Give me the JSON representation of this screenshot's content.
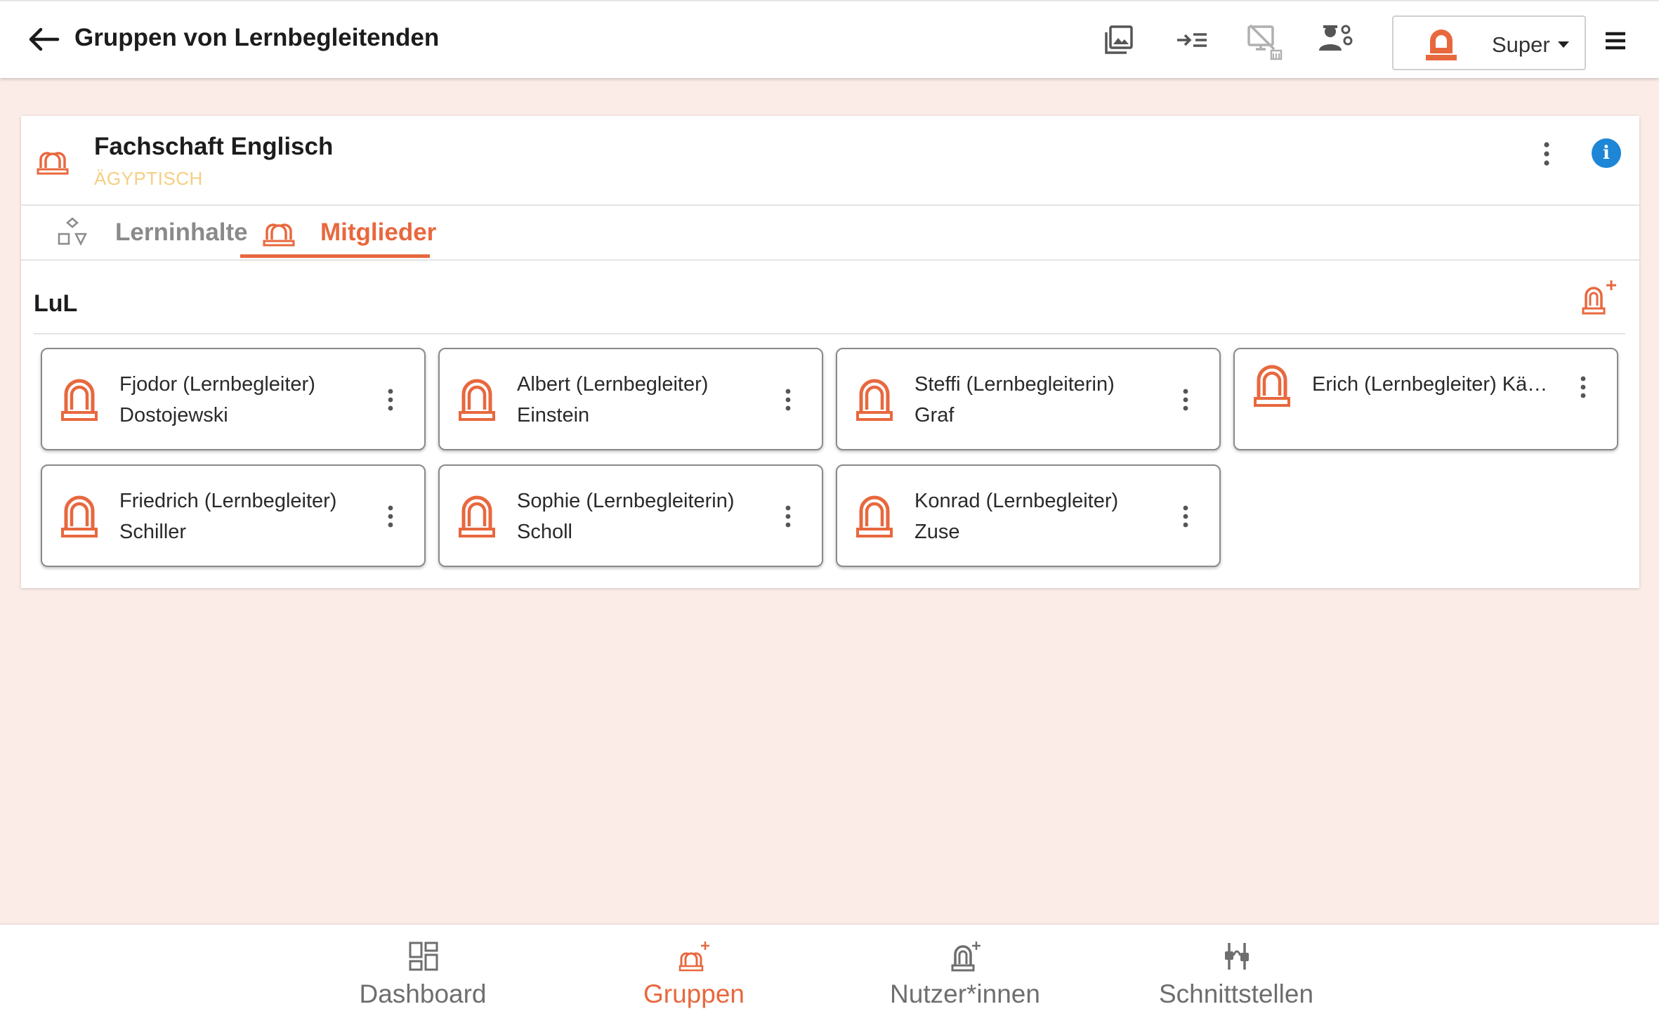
{
  "header": {
    "title": "Gruppen von Lernbegleitenden",
    "user_name": "Super"
  },
  "group": {
    "name": "Fachschaft Englisch",
    "subtitle": "ÄGYPTISCH",
    "info_label": "i"
  },
  "tabs": [
    {
      "label": "Lerninhalte",
      "active": false
    },
    {
      "label": "Mitglieder",
      "active": true
    }
  ],
  "section": {
    "title": "LuL"
  },
  "members": [
    {
      "line1": "Fjodor (Lernbegleiter)",
      "line2": "Dostojewski"
    },
    {
      "line1": "Albert (Lernbegleiter)",
      "line2": "Einstein"
    },
    {
      "line1": "Steffi (Lernbegleiterin)",
      "line2": "Graf"
    },
    {
      "line1": "Erich (Lernbegleiter) Käs…",
      "line2": ""
    },
    {
      "line1": "Friedrich (Lernbegleiter)",
      "line2": "Schiller"
    },
    {
      "line1": "Sophie (Lernbegleiterin)",
      "line2": "Scholl"
    },
    {
      "line1": "Konrad (Lernbegleiter)",
      "line2": "Zuse"
    }
  ],
  "bottom_nav": [
    {
      "label": "Dashboard",
      "icon": "dashboard-icon",
      "active": false
    },
    {
      "label": "Gruppen",
      "icon": "groups-add-icon",
      "active": true
    },
    {
      "label": "Nutzer*innen",
      "icon": "user-add-icon",
      "active": false
    },
    {
      "label": "Schnittstellen",
      "icon": "interfaces-icon",
      "active": false
    }
  ],
  "colors": {
    "accent": "#e8683e",
    "background": "#fcece8",
    "subtitle": "#f4cf82",
    "info": "#1d86d6"
  }
}
